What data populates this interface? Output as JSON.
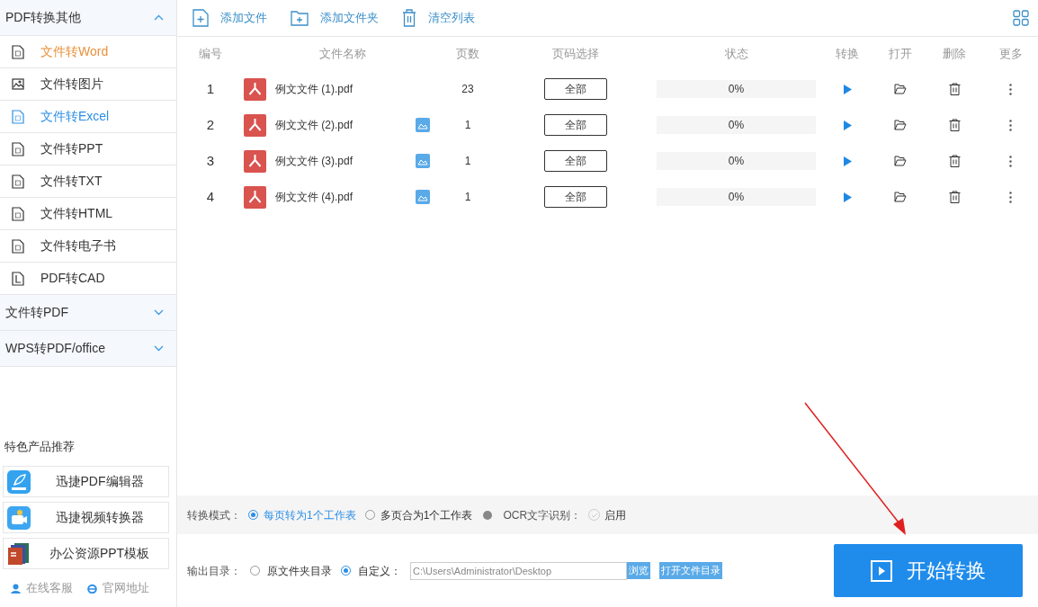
{
  "sidebar": {
    "groups": [
      {
        "title": "PDF转换其他",
        "expanded": true,
        "items": [
          {
            "label": "文件转Word",
            "kind": "word",
            "selected": false,
            "hovered": true
          },
          {
            "label": "文件转图片",
            "kind": "image",
            "selected": false,
            "hovered": false
          },
          {
            "label": "文件转Excel",
            "kind": "excel",
            "selected": true,
            "hovered": false
          },
          {
            "label": "文件转PPT",
            "kind": "ppt",
            "selected": false,
            "hovered": false
          },
          {
            "label": "文件转TXT",
            "kind": "txt",
            "selected": false,
            "hovered": false
          },
          {
            "label": "文件转HTML",
            "kind": "html",
            "selected": false,
            "hovered": false
          },
          {
            "label": "文件转电子书",
            "kind": "ebook",
            "selected": false,
            "hovered": false
          },
          {
            "label": "PDF转CAD",
            "kind": "cad",
            "selected": false,
            "hovered": false
          }
        ]
      },
      {
        "title": "文件转PDF",
        "expanded": false
      },
      {
        "title": "WPS转PDF/office",
        "expanded": false
      }
    ],
    "featured_title": "特色产品推荐",
    "products": [
      {
        "label": "迅捷PDF编辑器",
        "kind": "pdf"
      },
      {
        "label": "迅捷视频转换器",
        "kind": "video"
      },
      {
        "label": "办公资源PPT模板",
        "kind": "ppt"
      }
    ],
    "links": [
      {
        "label": "在线客服",
        "kind": "service"
      },
      {
        "label": "官网地址",
        "kind": "web"
      }
    ]
  },
  "toolbar": [
    {
      "label": "添加文件",
      "kind": "add-file"
    },
    {
      "label": "添加文件夹",
      "kind": "add-folder"
    },
    {
      "label": "清空列表",
      "kind": "clear"
    }
  ],
  "table": {
    "columns": [
      "编号",
      "文件名称",
      "页数",
      "页码选择",
      "状态",
      "转换",
      "打开",
      "删除",
      "更多"
    ],
    "rows": [
      {
        "number": "1",
        "name": "例文文件 (1).pdf",
        "preview": false,
        "pages": "23",
        "range": "全部",
        "level": 0,
        "status": "0%"
      },
      {
        "number": "2",
        "name": "例文文件 (2).pdf",
        "preview": true,
        "pages": "1",
        "range": "全部",
        "level": 0,
        "status": "0%"
      },
      {
        "number": "3",
        "name": "例文文件 (3).pdf",
        "preview": true,
        "pages": "1",
        "range": "全部",
        "level": 0,
        "status": "0%"
      },
      {
        "number": "4",
        "name": "例文文件 (4).pdf",
        "preview": true,
        "pages": "1",
        "range": "全部",
        "level": 0,
        "status": "0%"
      }
    ]
  },
  "mode": {
    "label": "转换模式：",
    "options": [
      {
        "label": "每页转为1个工作表",
        "selected": true
      },
      {
        "label": "多页合为1个工作表",
        "selected": false
      }
    ],
    "ocr_label": "OCR文字识别：",
    "ocr": {
      "label": "启用",
      "checked": false
    }
  },
  "output": {
    "label": "输出目录：",
    "options": [
      {
        "label": "原文件夹目录",
        "selected": false
      },
      {
        "label": "自定义：",
        "selected": true
      }
    ],
    "path": "C:\\Users\\Administrator\\Desktop",
    "browse": "浏览",
    "open_dir": "打开文件目录"
  },
  "start_button": "开始转换"
}
